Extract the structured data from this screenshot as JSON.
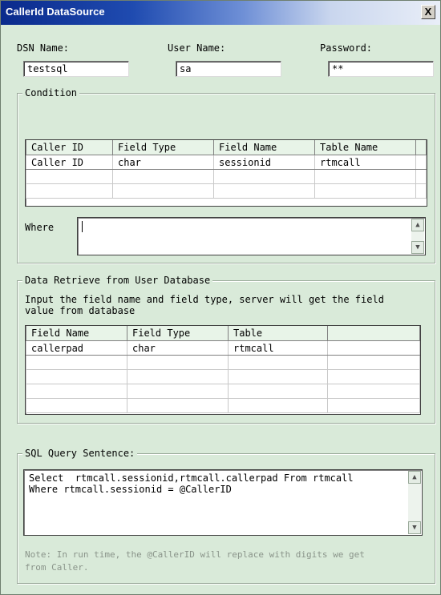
{
  "window": {
    "title": "CallerId DataSource",
    "close_label": "X"
  },
  "connection": {
    "dsn_label": "DSN Name:",
    "dsn_value": "testsql",
    "user_label": "User Name:",
    "user_value": "sa",
    "password_label": "Password:",
    "password_value": "**"
  },
  "condition": {
    "legend": "Condition",
    "columns": [
      "Caller ID",
      "Field Type",
      "Field Name",
      "Table Name"
    ],
    "rows": [
      [
        "Caller ID",
        "char",
        "sessionid",
        "rtmcall"
      ]
    ],
    "where_label": "Where",
    "where_value": ""
  },
  "retrieve": {
    "legend": "Data Retrieve from User Database",
    "description_line1": "Input the field name and field type, server will get the field",
    "description_line2": "value from database",
    "columns": [
      "Field Name",
      "Field Type",
      "Table",
      ""
    ],
    "rows": [
      [
        "callerpad",
        "char",
        "rtmcall",
        ""
      ]
    ]
  },
  "sql": {
    "legend": "SQL Query Sentence:",
    "line1": "Select  rtmcall.sessionid,rtmcall.callerpad From rtmcall",
    "line2": "Where rtmcall.sessionid = @CallerID",
    "note_line1": "Note: In run time, the @CallerID will replace with digits we get",
    "note_line2": "from Caller."
  },
  "scroll_up_glyph": "▲",
  "scroll_down_glyph": "▼"
}
